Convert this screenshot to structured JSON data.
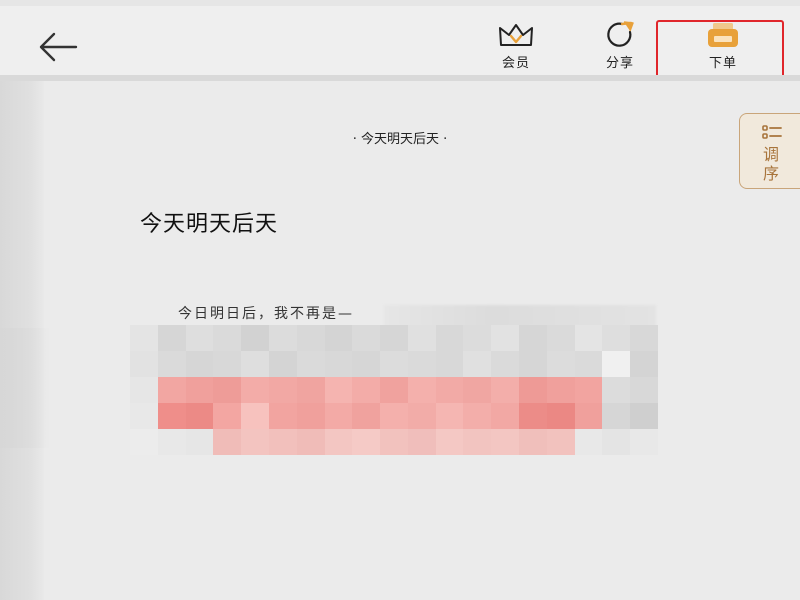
{
  "toolbar": {
    "vip_label": "会员",
    "share_label": "分享",
    "order_label": "下单"
  },
  "reader": {
    "running_title": "· 今天明天后天 ·",
    "chapter_title": "今天明天后天",
    "body_first_line": "今日明日后，我不再是—"
  },
  "side_tab": {
    "label_line1": "调",
    "label_line2": "序"
  },
  "colors": {
    "accent_gold": "#e8a13a",
    "highlight_red": "#e0262b",
    "tab_brown": "#a8743b"
  }
}
